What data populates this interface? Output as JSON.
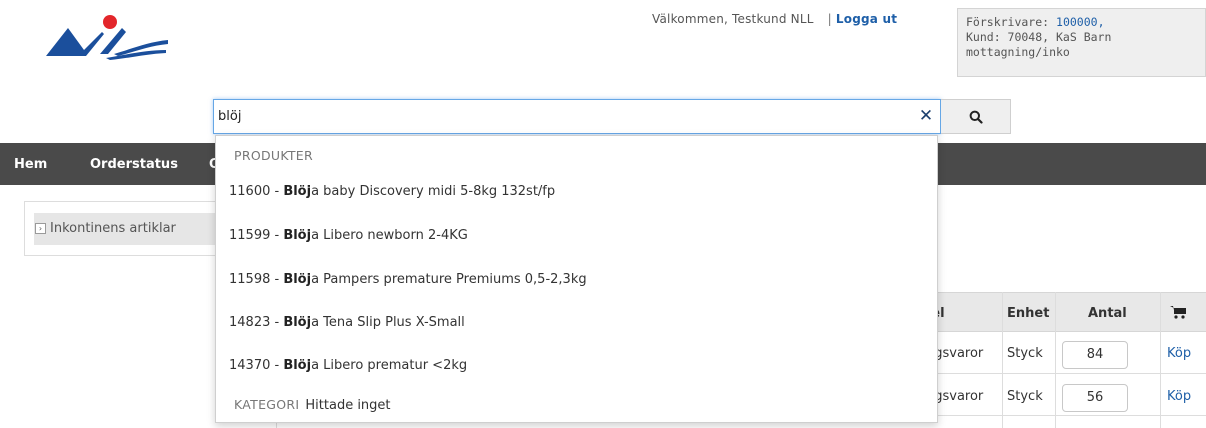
{
  "header": {
    "welcome_text": "Välkommen,  Testkund NLL",
    "separator": "|",
    "logout_label": "Logga ut"
  },
  "prescriber": {
    "label": "Förskrivare:",
    "id": "100000,",
    "line2": "Kund: 70048, KaS Barn",
    "line3": "mottagning/inko"
  },
  "search": {
    "value": "blöj",
    "clear_icon": "close-icon",
    "button_icon": "search-icon"
  },
  "nav": {
    "items": [
      {
        "label": "Hem"
      },
      {
        "label": "Orderstatus"
      },
      {
        "label": "O"
      }
    ]
  },
  "left_panel": {
    "items": [
      {
        "label": "Inkontinens artiklar"
      }
    ]
  },
  "table": {
    "headers": {
      "col_group": "gel",
      "unit": "Enhet",
      "quantity": "Antal",
      "cart_icon": "cart-icon"
    },
    "rows": [
      {
        "group": "ngsvaror",
        "unit": "Styck",
        "quantity": "84",
        "buy": "Köp"
      },
      {
        "group": "ngsvaror",
        "unit": "Styck",
        "quantity": "56",
        "buy": "Köp"
      }
    ]
  },
  "dropdown": {
    "products_header": "PRODUKTER",
    "items": [
      {
        "code": "11600 - ",
        "match": "Blöj",
        "rest": "a baby Discovery midi 5-8kg 132st/fp"
      },
      {
        "code": "11599 - ",
        "match": "Blöj",
        "rest": "a Libero newborn 2-4KG"
      },
      {
        "code": "11598 - ",
        "match": "Blöj",
        "rest": "a Pampers premature Premiums 0,5-2,3kg"
      },
      {
        "code": "14823 - ",
        "match": "Blöj",
        "rest": "a Tena Slip Plus X-Small"
      },
      {
        "code": "14370 - ",
        "match": "Blöj",
        "rest": "a Libero prematur <2kg"
      }
    ],
    "category_label": "KATEGORI",
    "category_value": "Hittade inget"
  },
  "colors": {
    "nav_bg": "#4a4a4a",
    "link": "#1e5fa8",
    "logo_blue": "#1b4f9c",
    "logo_red": "#e3262b"
  }
}
